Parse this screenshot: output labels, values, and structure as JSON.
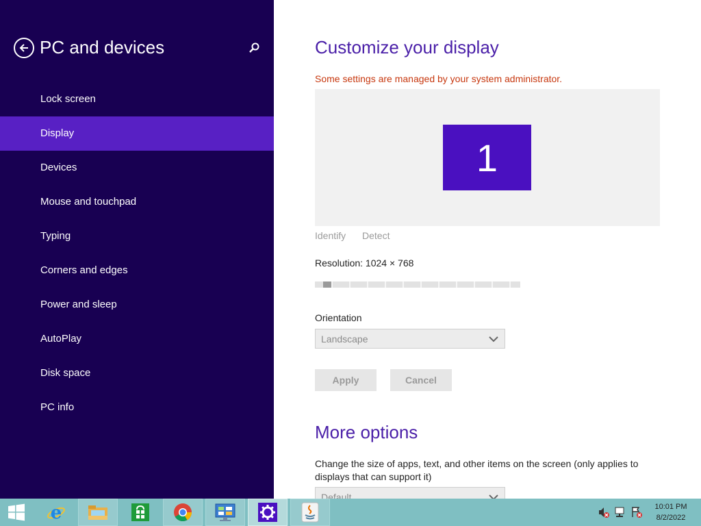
{
  "nav": {
    "title": "PC and devices",
    "back_icon": "arrow-left-circle-icon",
    "search_icon": "search-icon",
    "items": [
      {
        "label": "Lock screen"
      },
      {
        "label": "Display",
        "selected": true
      },
      {
        "label": "Devices"
      },
      {
        "label": "Mouse and touchpad"
      },
      {
        "label": "Typing"
      },
      {
        "label": "Corners and edges"
      },
      {
        "label": "Power and sleep"
      },
      {
        "label": "AutoPlay"
      },
      {
        "label": "Disk space"
      },
      {
        "label": "PC info"
      }
    ]
  },
  "display": {
    "title": "Customize your display",
    "admin_note": "Some settings are managed by your system administrator.",
    "monitor_number": "1",
    "identify_label": "Identify",
    "detect_label": "Detect",
    "resolution_label": "Resolution: 1024 × 768",
    "orientation_label": "Orientation",
    "orientation_value": "Landscape",
    "apply_label": "Apply",
    "cancel_label": "Cancel"
  },
  "more_options": {
    "title": "More options",
    "description": "Change the size of apps, text, and other items on the screen (only applies to displays that can support it)",
    "size_value": "Default"
  },
  "taskbar": {
    "items": [
      {
        "name": "start",
        "icon": "windows-logo-icon"
      },
      {
        "name": "internet-explorer",
        "icon": "internet-explorer-icon"
      },
      {
        "name": "file-explorer",
        "icon": "folder-icon"
      },
      {
        "name": "store",
        "icon": "store-icon"
      },
      {
        "name": "chrome",
        "icon": "chrome-icon"
      },
      {
        "name": "control-panel",
        "icon": "control-panel-icon"
      },
      {
        "name": "pc-settings",
        "icon": "gear-icon",
        "active": true
      },
      {
        "name": "java",
        "icon": "java-icon"
      }
    ],
    "tray_icons": [
      "speaker-muted-icon",
      "network-icon",
      "action-center-icon"
    ],
    "time": "10:01 PM",
    "date": "8/2/2022"
  },
  "colors": {
    "nav_bg": "#180052",
    "nav_selected": "#5820c4",
    "accent": "#4a10c0",
    "title": "#4a1fa8",
    "warning": "#c7380f",
    "taskbar": "#7fbfc2"
  }
}
